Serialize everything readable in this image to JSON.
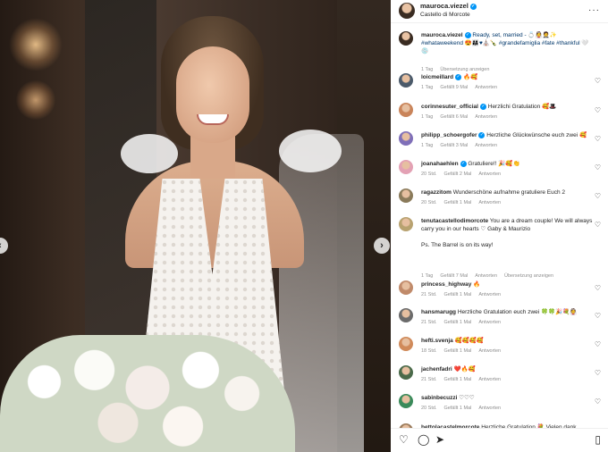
{
  "post": {
    "username": "mauroca.viezel",
    "location": "Castello di Morcote",
    "caption_user": "mauroca.viezel",
    "caption_text": "Ready, set, married - 💍👰🤵✨ #whataweekend 😍👨‍👩‍👧♥⛪🍾 #grandefamiglia #fate #thankful 🤍💿",
    "caption_time": "1 Tag",
    "caption_translate": "Übersetzung anzeigen"
  },
  "comments": [
    {
      "user": "loicmeillard",
      "verified": true,
      "text": "🔥🥰",
      "time": "1 Tag",
      "likes": "Gefällt 9 Mal",
      "reply": "Antworten",
      "color": "#4b5a6a"
    },
    {
      "user": "corinnesuter_official",
      "verified": true,
      "text": "Herzlichi Gratulation 🥰🎩",
      "time": "1 Tag",
      "likes": "Gefällt 6 Mal",
      "reply": "Antworten",
      "color": "#c9845a"
    },
    {
      "user": "philipp_schoergofer",
      "verified": true,
      "text": "Herzliche Glückwünsche euch zwei 🥰",
      "time": "1 Tag",
      "likes": "Gefällt 3 Mal",
      "reply": "Antworten",
      "color": "#7f6fb8"
    },
    {
      "user": "joanahaehlen",
      "verified": true,
      "text": "Gratuliere!! 🎉🥰👏",
      "time": "20 Std.",
      "likes": "Gefällt 2 Mal",
      "reply": "Antworten",
      "color": "#e3a1b4"
    },
    {
      "user": "ragazzitom",
      "verified": false,
      "text": "Wunderschöne aufnahme gratuliere Euch 2",
      "time": "20 Std.",
      "likes": "Gefällt 1 Mal",
      "reply": "Antworten",
      "color": "#8a7a5a"
    },
    {
      "user": "tenutacastellodimorcote",
      "verified": false,
      "text": "You are a dream couple! We will always carry you in our hearts ♡ Gaby & Maurizio\n\nPs. The Barrel is on its way!",
      "time": "1 Tag",
      "likes": "Gefällt 7 Mal",
      "reply": "Antworten",
      "translate": "Übersetzung anzeigen",
      "color": "#b8a270"
    },
    {
      "user": "princess_highway",
      "verified": false,
      "text": "🔥",
      "time": "21 Std.",
      "likes": "Gefällt 1 Mal",
      "reply": "Antworten",
      "color": "#c08a6a"
    },
    {
      "user": "hansmarugg",
      "verified": false,
      "text": "Herzliche Gratulation euch zwei 🍀🍀🎉💐👰",
      "time": "21 Std.",
      "likes": "Gefällt 1 Mal",
      "reply": "Antworten",
      "color": "#6b6b6b"
    },
    {
      "user": "hefti.svenja",
      "verified": false,
      "text": "🥰🥰🥰🥰",
      "time": "18 Std.",
      "likes": "Gefällt 1 Mal",
      "reply": "Antworten",
      "color": "#d08a5a"
    },
    {
      "user": "jachenfadri",
      "verified": false,
      "text": "❤️🔥🥰",
      "time": "21 Std.",
      "likes": "Gefällt 1 Mal",
      "reply": "Antworten",
      "color": "#4a6a4a"
    },
    {
      "user": "sabinbecuzzi",
      "verified": false,
      "text": "♡♡♡",
      "time": "20 Std.",
      "likes": "Gefällt 1 Mal",
      "reply": "Antworten",
      "color": "#3a8a5a"
    },
    {
      "user": "bettolacastelmorcote",
      "verified": false,
      "text": "Herzliche Gratulation 💐 Vielen dank",
      "time": "",
      "likes": "",
      "reply": "",
      "color": "#9a7a5a"
    }
  ],
  "icons": {
    "like": "heart-icon",
    "comment": "comment-icon",
    "share": "share-icon",
    "save": "bookmark-icon",
    "more": "more-icon",
    "verified": "verified-badge-icon"
  },
  "colors": {
    "link": "#00376b",
    "verified": "#0095f6",
    "meta": "#8e8e8e"
  }
}
